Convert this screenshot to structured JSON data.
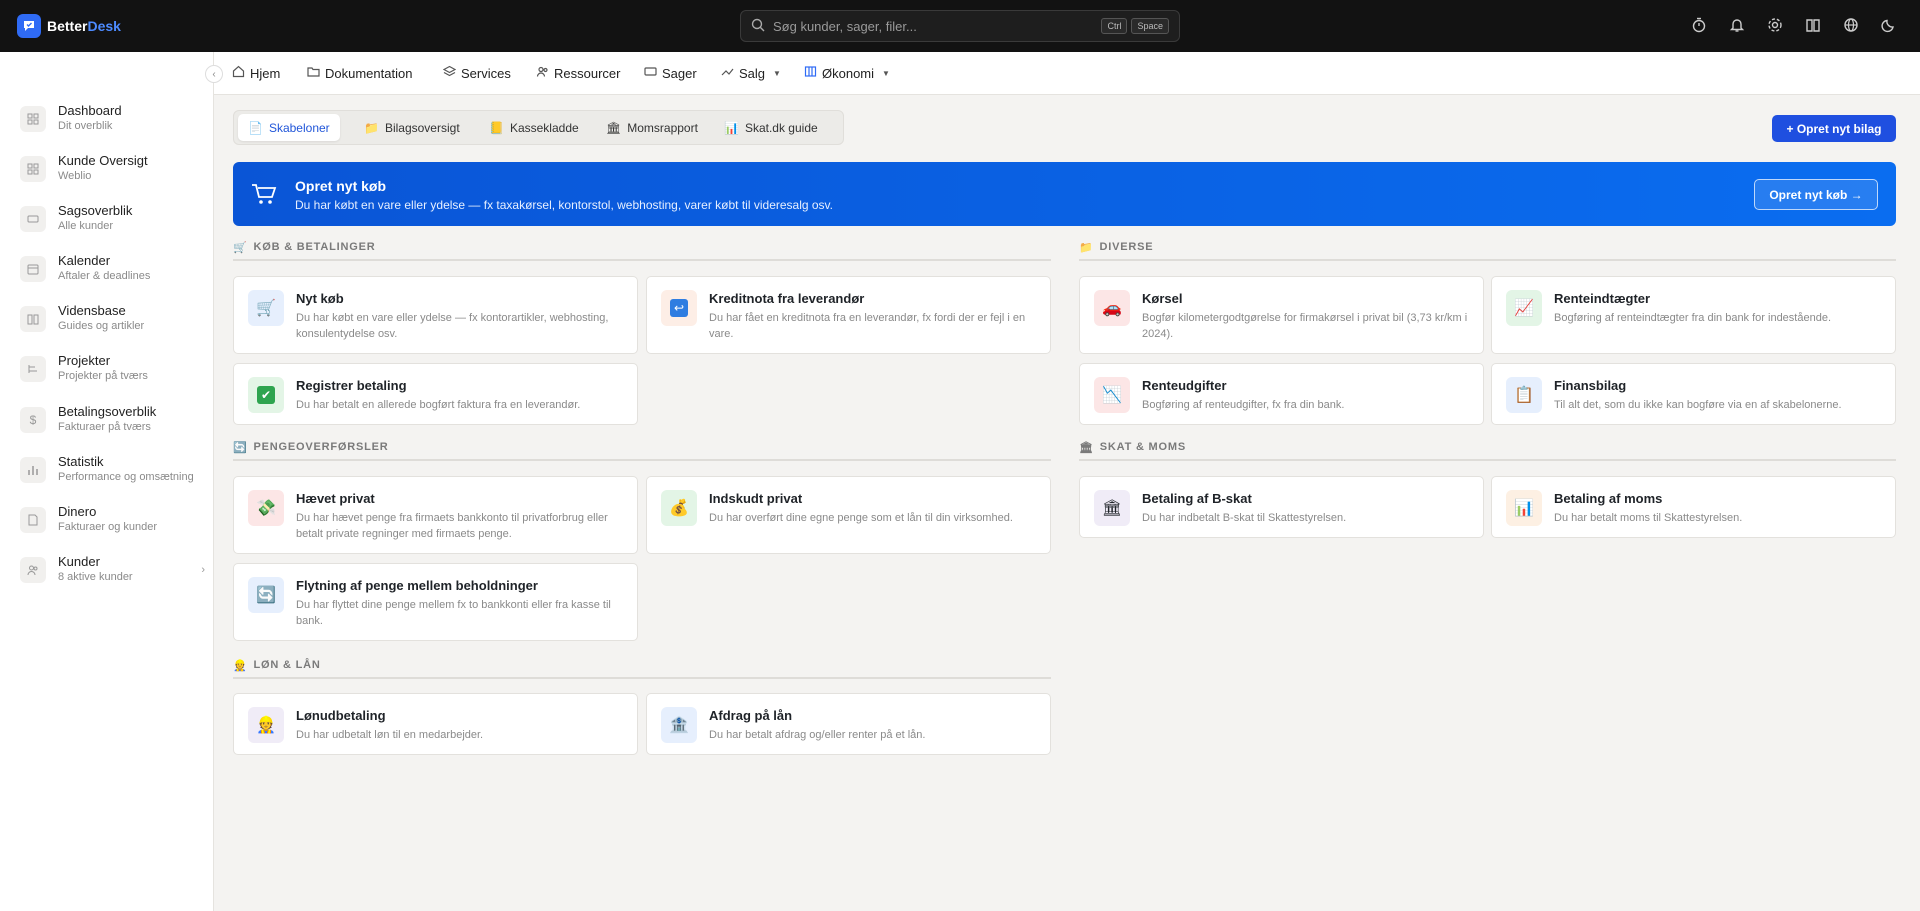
{
  "app": {
    "logo_a": "Better",
    "logo_b": "Desk"
  },
  "search": {
    "placeholder": "Søg kunder, sager, filer...",
    "kbd1": "Ctrl",
    "kbd2": "Space"
  },
  "sidebar": {
    "items": [
      {
        "title": "Dashboard",
        "sub": "Dit overblik"
      },
      {
        "title": "Kunde Oversigt",
        "sub": "Weblio"
      },
      {
        "title": "Sagsoverblik",
        "sub": "Alle kunder"
      },
      {
        "title": "Kalender",
        "sub": "Aftaler & deadlines"
      },
      {
        "title": "Vidensbase",
        "sub": "Guides og artikler"
      },
      {
        "title": "Projekter",
        "sub": "Projekter på tværs"
      },
      {
        "title": "Betalingsoverblik",
        "sub": "Fakturaer på tværs"
      },
      {
        "title": "Statistik",
        "sub": "Performance og omsætning"
      },
      {
        "title": "Dinero",
        "sub": "Fakturaer og kunder"
      },
      {
        "title": "Kunder",
        "sub": "8 aktive kunder"
      }
    ]
  },
  "nav": {
    "hjem": "Hjem",
    "dok": "Dokumentation",
    "services": "Services",
    "ressourcer": "Ressourcer",
    "sager": "Sager",
    "salg": "Salg",
    "okonomi": "Økonomi"
  },
  "tabs": {
    "t1": "Skabeloner",
    "t2": "Bilagsoversigt",
    "t3": "Kassekladde",
    "t4": "Momsrapport",
    "t5": "Skat.dk guide"
  },
  "new_button": "+ Opret nyt bilag",
  "banner": {
    "title": "Opret nyt køb",
    "sub": "Du har købt en vare eller ydelse — fx taxakørsel, kontorstol, webhosting, varer købt til videresalg osv.",
    "button": "Opret nyt køb →"
  },
  "sections": {
    "kob": {
      "title": "KØB & BETALINGER",
      "icon": "🛒"
    },
    "penge": {
      "title": "PENGEOVERFØRSLER",
      "icon": "🔄"
    },
    "lon": {
      "title": "LØN & LÅN",
      "icon": "👷"
    },
    "diverse": {
      "title": "DIVERSE",
      "icon": "📁"
    },
    "skat": {
      "title": "SKAT & MOMS",
      "icon": "🏛"
    }
  },
  "cards": {
    "nyt_kob": {
      "title": "Nyt køb",
      "desc": "Du har købt en vare eller ydelse — fx kontorartikler, webhosting, konsulentydelse osv.",
      "icon": "🛒"
    },
    "kreditnota": {
      "title": "Kreditnota fra leverandør",
      "desc": "Du har fået en kreditnota fra en leverandør, fx fordi der er fejl i en vare.",
      "icon": "↩"
    },
    "registrer": {
      "title": "Registrer betaling",
      "desc": "Du har betalt en allerede bogført faktura fra en leverandør.",
      "icon": "✔"
    },
    "haevet": {
      "title": "Hævet privat",
      "desc": "Du har hævet penge fra firmaets bankkonto til privatforbrug eller betalt private regninger med firmaets penge.",
      "icon": "💸"
    },
    "indskudt": {
      "title": "Indskudt privat",
      "desc": "Du har overført dine egne penge som et lån til din virksomhed.",
      "icon": "💰"
    },
    "flytning": {
      "title": "Flytning af penge mellem beholdninger",
      "desc": "Du har flyttet dine penge mellem fx to bankkonti eller fra kasse til bank.",
      "icon": "🔄"
    },
    "lonudbetaling": {
      "title": "Lønudbetaling",
      "desc": "Du har udbetalt løn til en medarbejder.",
      "icon": "👷"
    },
    "afdrag": {
      "title": "Afdrag på lån",
      "desc": "Du har betalt afdrag og/eller renter på et lån.",
      "icon": "🏦"
    },
    "korsel": {
      "title": "Kørsel",
      "desc": "Bogfør kilometergodtgørelse for firmakørsel i privat bil (3,73 kr/km i 2024).",
      "icon": "🚗"
    },
    "renteindtaegter": {
      "title": "Renteindtægter",
      "desc": "Bogføring af renteindtægter fra din bank for indestående.",
      "icon": "📈"
    },
    "renteudgifter": {
      "title": "Renteudgifter",
      "desc": "Bogføring af renteudgifter, fx fra din bank.",
      "icon": "📉"
    },
    "finansbilag": {
      "title": "Finansbilag",
      "desc": "Til alt det, som du ikke kan bogføre via en af skabelonerne.",
      "icon": "📋"
    },
    "bskat": {
      "title": "Betaling af B-skat",
      "desc": "Du har indbetalt B-skat til Skattestyrelsen.",
      "icon": "🏛"
    },
    "moms": {
      "title": "Betaling af moms",
      "desc": "Du har betalt moms til Skattestyrelsen.",
      "icon": "📊"
    }
  }
}
